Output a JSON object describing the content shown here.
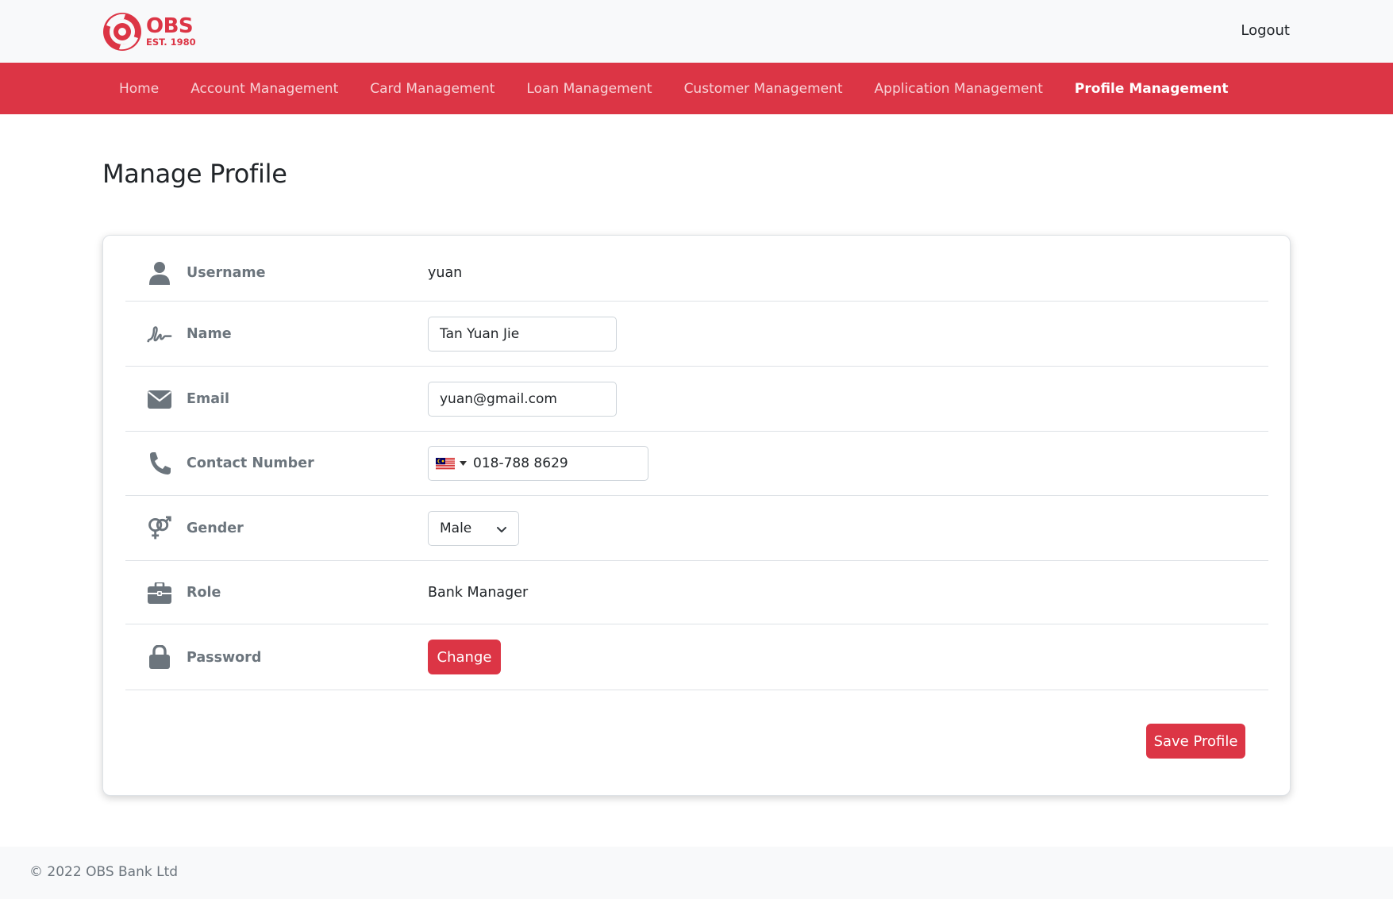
{
  "brand": {
    "name": "OBS",
    "est": "EST. 1980",
    "color": "#dc3545"
  },
  "header": {
    "logout_label": "Logout"
  },
  "nav": {
    "items": [
      {
        "label": "Home",
        "active": false
      },
      {
        "label": "Account Management",
        "active": false
      },
      {
        "label": "Card Management",
        "active": false
      },
      {
        "label": "Loan Management",
        "active": false
      },
      {
        "label": "Customer Management",
        "active": false
      },
      {
        "label": "Application Management",
        "active": false
      },
      {
        "label": "Profile Management",
        "active": true
      }
    ]
  },
  "page": {
    "title": "Manage Profile"
  },
  "profile": {
    "username": {
      "label": "Username",
      "icon": "user-icon",
      "value": "yuan"
    },
    "name": {
      "label": "Name",
      "icon": "signature-icon",
      "value": "Tan Yuan Jie"
    },
    "email": {
      "label": "Email",
      "icon": "envelope-icon",
      "value": "yuan@gmail.com"
    },
    "contact": {
      "label": "Contact Number",
      "icon": "phone-icon",
      "country_flag": "malaysia-flag-icon",
      "value": "018-788 8629"
    },
    "gender": {
      "label": "Gender",
      "icon": "venus-mars-icon",
      "selected": "Male"
    },
    "role": {
      "label": "Role",
      "icon": "briefcase-icon",
      "value": "Bank Manager"
    },
    "password": {
      "label": "Password",
      "icon": "lock-icon",
      "change_label": "Change"
    }
  },
  "actions": {
    "save_label": "Save Profile"
  },
  "footer": {
    "text": "© 2022 OBS Bank Ltd"
  }
}
